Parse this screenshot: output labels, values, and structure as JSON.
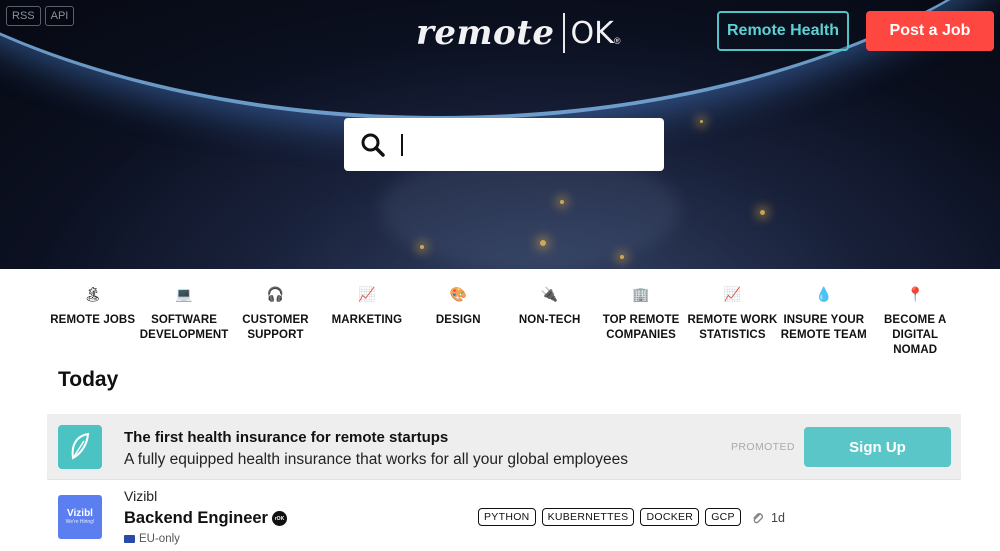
{
  "header": {
    "top_links": [
      "RSS",
      "API"
    ],
    "logo_word": "remote",
    "logo_ok": "OK",
    "logo_mark": "®",
    "remote_health_label": "Remote Health",
    "post_job_label": "Post a Job"
  },
  "search": {
    "value": "",
    "placeholder": ""
  },
  "categories": [
    {
      "icon": "🏝",
      "label": "REMOTE JOBS"
    },
    {
      "icon": "💻",
      "label": "SOFTWARE DEVELOPMENT"
    },
    {
      "icon": "🎧",
      "label": "CUSTOMER SUPPORT"
    },
    {
      "icon": "📈",
      "label": "MARKETING"
    },
    {
      "icon": "🎨",
      "label": "DESIGN"
    },
    {
      "icon": "🔌",
      "label": "NON-TECH"
    },
    {
      "icon": "🏢",
      "label": "TOP REMOTE COMPANIES"
    },
    {
      "icon": "📈",
      "label": "REMOTE WORK STATISTICS"
    },
    {
      "icon": "💧",
      "label": "INSURE YOUR REMOTE TEAM"
    },
    {
      "icon": "📍",
      "label": "BECOME A DIGITAL NOMAD"
    }
  ],
  "section_title": "Today",
  "promo": {
    "title": "The first health insurance for remote startups",
    "description": "A fully equipped health insurance that works for all your global employees",
    "tag": "PROMOTED",
    "button_label": "Sign Up"
  },
  "job": {
    "logo_name": "Vizibl",
    "logo_sub": "We're Hiring!",
    "company": "Vizibl",
    "title": "Backend Engineer",
    "verified_mark": "rOK",
    "location": "EU-only",
    "tags": [
      "PYTHON",
      "KUBERNETTES",
      "DOCKER",
      "GCP"
    ],
    "time": "1d"
  },
  "colors": {
    "accent": "#5bc6c8",
    "post_button": "#ff4742",
    "job_logo": "#5b7ef0"
  }
}
